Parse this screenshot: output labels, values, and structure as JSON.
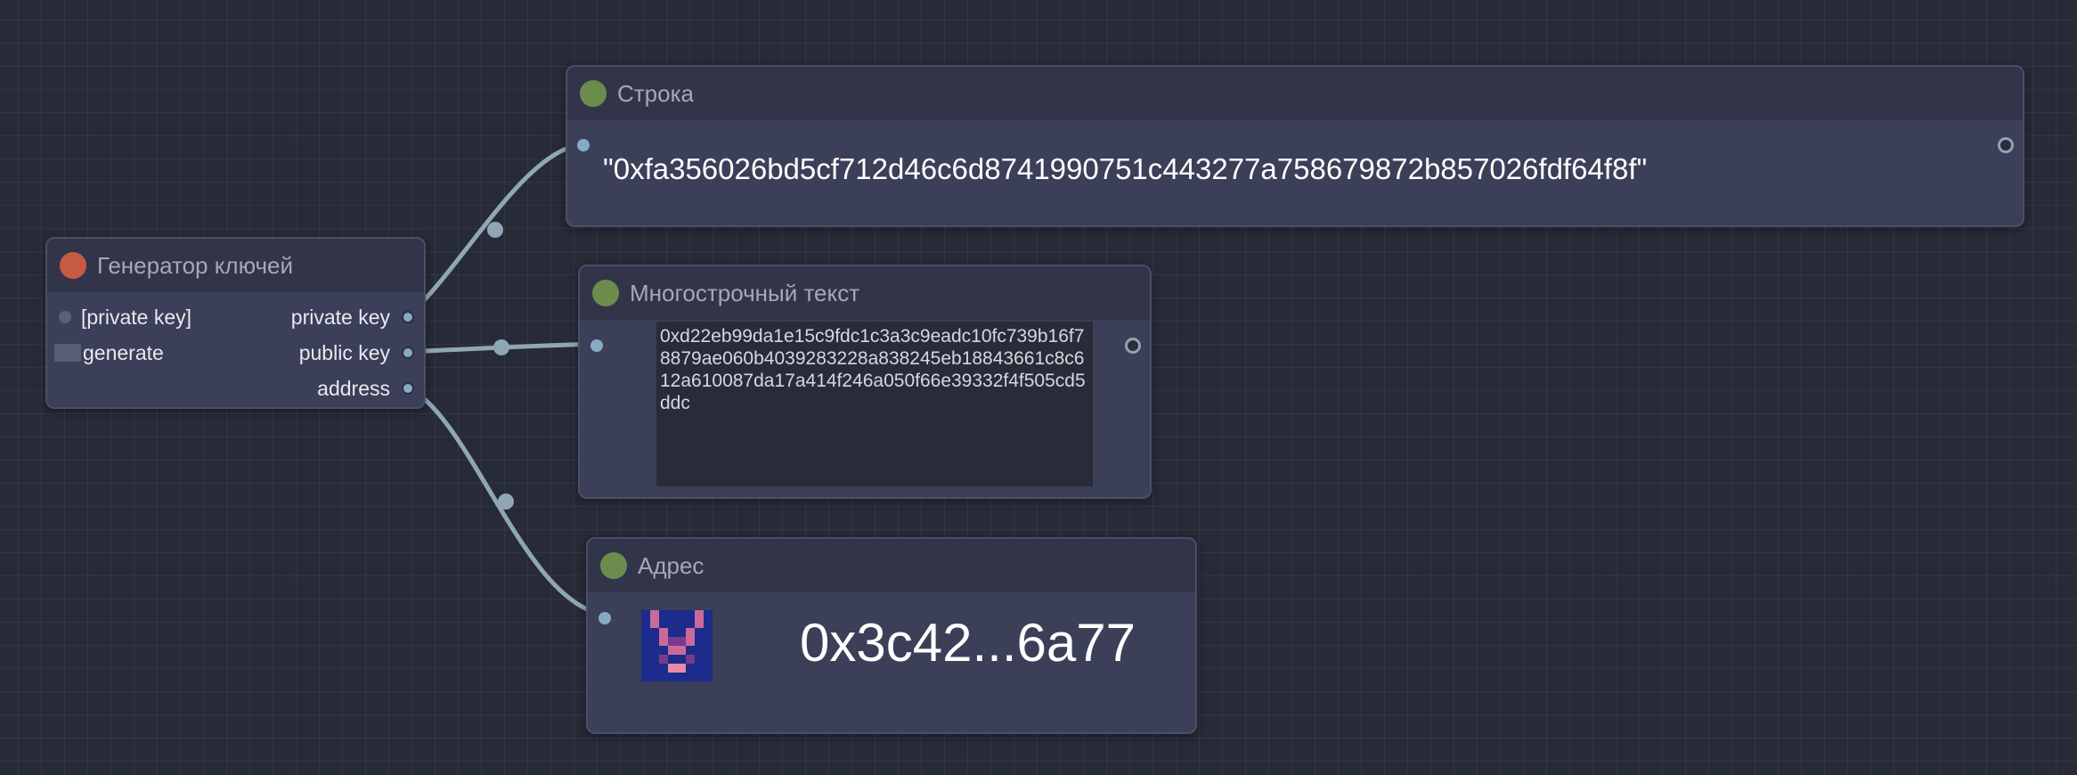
{
  "nodes": {
    "keygen": {
      "title": "Генератор ключей",
      "input_private_key": "[private key]",
      "input_generate": "generate",
      "output_private_key": "private key",
      "output_public_key": "public key",
      "output_address": "address"
    },
    "string": {
      "title": "Строка",
      "value": "\"0xfa356026bd5cf712d46c6d8741990751c443277a758679872b857026fdf64f8f\""
    },
    "multiline": {
      "title": "Многострочный текст",
      "value": "0xd22eb99da1e15c9fdc1c3a3c9eadc10fc739b16f78879ae060b4039283228a838245eb18843661c8c612a610087da17a414f246a050f66e39332f4f505cd5ddc"
    },
    "address": {
      "title": "Адрес",
      "value": "0x3c42...6a77",
      "avatar_icon": "identicon-avatar"
    }
  },
  "colors": {
    "canvas_bg": "#272a37",
    "node_body": "#3b3f58",
    "node_header": "#32354a",
    "status_green": "#6c8c4e",
    "status_red": "#c75a45",
    "wire": "#8fa7b4",
    "slot": "#87aac6"
  }
}
